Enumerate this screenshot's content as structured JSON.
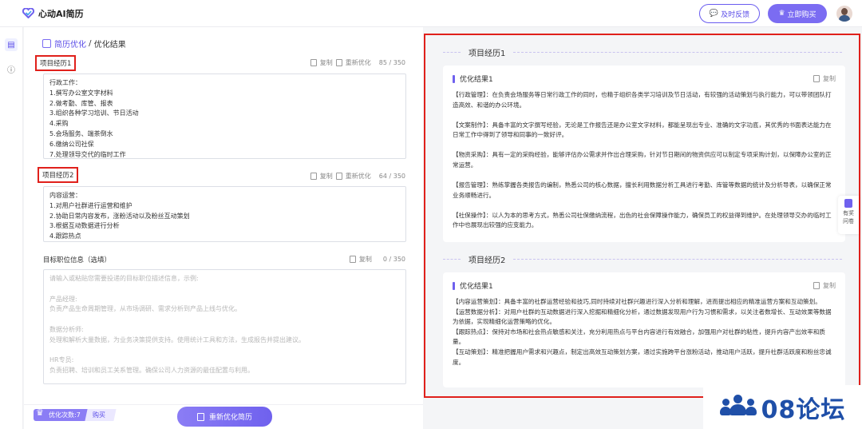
{
  "header": {
    "app_name": "心动AI简历",
    "feedback_label": "及时反馈",
    "buy_label": "立即购买"
  },
  "breadcrumb": {
    "root": "简历优化",
    "separator": " / ",
    "current": "优化结果"
  },
  "editor": {
    "sections": [
      {
        "title": "项目经历1",
        "copy_label": "复制",
        "reopt_label": "重新优化",
        "count": "85 / 350",
        "lines": [
          "行政工作：",
          "1.撰写办公室文字材料",
          "2.做考勤、库管、报表",
          "3.组织各种学习培训、节日活动",
          "4.采购",
          "5.会场服务、端茶倒水",
          "6.缴纳公司社保",
          "7.处理领导交代的临时工作"
        ]
      },
      {
        "title": "项目经历2",
        "copy_label": "复制",
        "reopt_label": "重新优化",
        "count": "64 / 350",
        "lines": [
          "内容运营：",
          "1.对用户社群进行运营和维护",
          "2.协助日常内容发布，涨粉活动以及粉丝互动策划",
          "3.根据互动数据进行分析",
          "4.跟踪热点"
        ]
      }
    ],
    "target": {
      "title": "目标职位信息（选填）",
      "copy_label": "复制",
      "count": "0 / 350",
      "placeholder_lines": [
        "请输入或粘贴您需要投递的目标职位描述信息，示例:",
        "",
        "产品经理:",
        "负责产品生命周期管理，从市场调研、需求分析到产品上线与优化。",
        "",
        "数据分析师:",
        "处理和解析大量数据，为业务决策提供支持。使用统计工具和方法，生成报告并提出建议。",
        "",
        "HR专员:",
        "负责招聘、培训和员工关系管理。确保公司人力资源的最佳配置与利用。"
      ]
    }
  },
  "bottom": {
    "quota_label": "优化次数:7",
    "quota_buy": "购买",
    "reopt_button": "重新优化简历"
  },
  "results": [
    {
      "section": "项目经历1",
      "card_title": "优化结果1",
      "copy_label": "复制",
      "paragraphs": [
        "【行政管理】：在负责会场服务等日常行政工作的同时，也精于组织各类学习培训及节日活动，有较强的活动策划与执行能力，可以带领团队打造高效、和谐的办公环境。",
        "【文案制作】：具备丰富的文字撰写经验，无论是工作报告还是办公室文字材料，都能呈现出专业、准确的文字功底，其优秀的书面表达能力在日常工作中得到了领导和同事的一致好评。",
        "【物资采购】：具有一定的采购经验，能够评估办公需求并作出合理采购，针对节日期间的物资供应可以制定专项采购计划，以保障办公室的正常运营。",
        "【报告管理】：熟练掌握各类报告的编制，熟悉公司的核心数据，擅长利用数据分析工具进行考勤、库管等数据的统计及分析导表，以确保正常业务顺畅进行。",
        "【社保操作】：以人为本的思考方式，熟悉公司社保缴纳流程，出色的社会保障操作能力，确保员工的权益得到维护。在处理领导交办的临时工作中也展现出较强的应变能力。"
      ]
    },
    {
      "section": "项目经历2",
      "card_title": "优化结果1",
      "copy_label": "复制",
      "paragraphs": [
        "【内容运营策划】：具备丰富的社群运营经验和技巧,同时持续对社群兴趣进行深入分析和理解，进而提出相应的精准运营方案和互动策划。",
        "【运营数据分析】：对用户社群的互动数据进行深入挖掘和精细化分析，通过数据发现用户行为习惯和需求，以关注者数增长、互动效果等数据为依据，实现精细化运营策略的优化。",
        "【跟踪热点】：保持对市场和社会热点敏感和关注，充分利用热点与平台内容进行有效融合，加强用户对社群的粘性，提升内容产出效率和质量。",
        "【互动策划】：精准把握用户需求和兴趣点，制定出高效互动策划方案，通过实施跨平台涨粉活动，推动用户活跃，提升社群活跃度和粉丝忠诚度。"
      ]
    }
  ],
  "side_float": {
    "label_line1": "有奖",
    "label_line2": "问卷"
  },
  "watermark": {
    "text": "08论坛"
  },
  "colors": {
    "accent": "#6f61ee",
    "highlight_red": "#e0201b",
    "watermark_blue": "#1f4fa8"
  }
}
